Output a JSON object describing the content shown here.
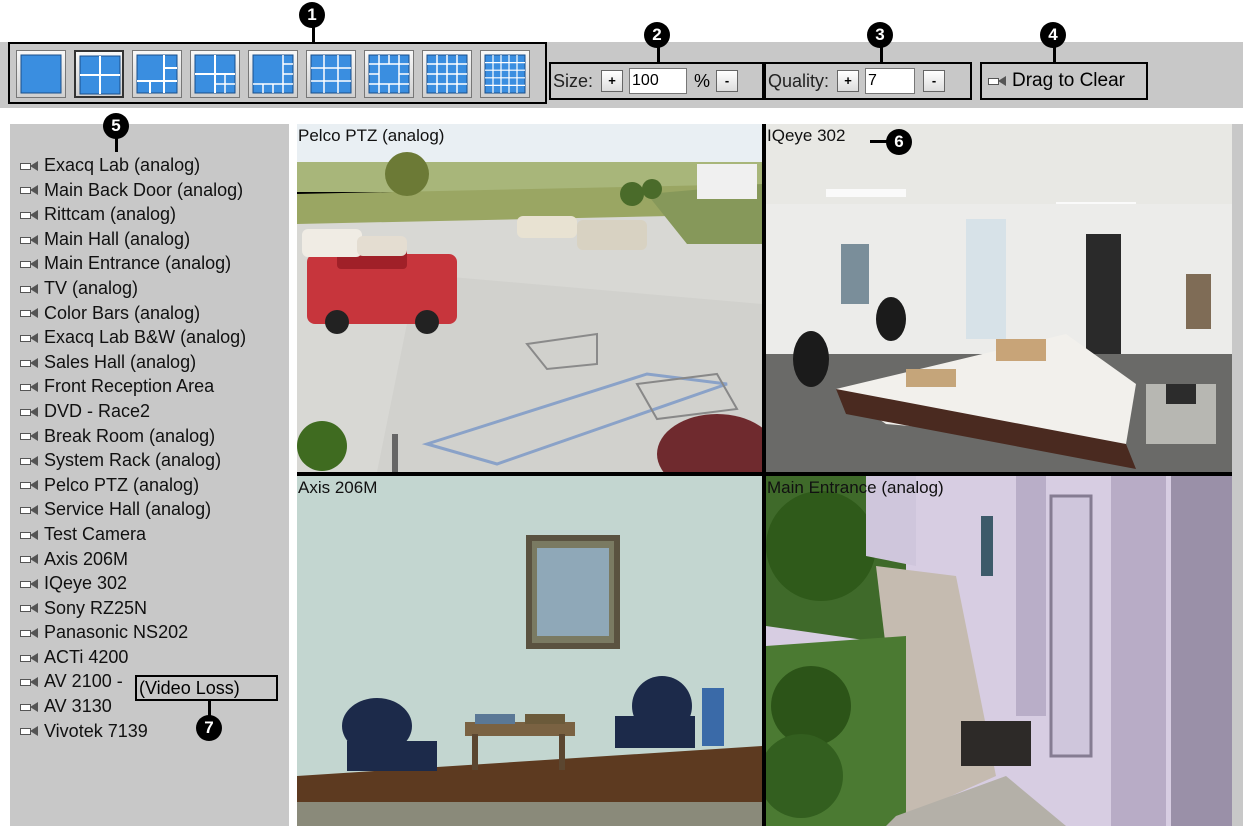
{
  "toolbar": {
    "layouts": [
      {
        "name": "1x1"
      },
      {
        "name": "2x2"
      },
      {
        "name": "1+5"
      },
      {
        "name": "1+7"
      },
      {
        "name": "1+9"
      },
      {
        "name": "3x3"
      },
      {
        "name": "1+12"
      },
      {
        "name": "4x4"
      },
      {
        "name": "5x5"
      }
    ],
    "size": {
      "label": "Size:",
      "plus": "+",
      "value": "100",
      "unit": "%",
      "minus": "-"
    },
    "quality": {
      "label": "Quality:",
      "plus": "+",
      "value": "7",
      "minus": "-"
    },
    "clear": {
      "label": "Drag to Clear"
    }
  },
  "callouts": [
    "1",
    "2",
    "3",
    "4",
    "5",
    "6",
    "7"
  ],
  "cameras": [
    "Exacq Lab (analog)",
    "Main Back Door (analog)",
    "Rittcam (analog)",
    "Main Hall (analog)",
    "Main Entrance (analog)",
    "TV (analog)",
    "Color Bars (analog)",
    "Exacq Lab B&W (analog)",
    "Sales Hall (analog)",
    "Front Reception Area",
    "DVD - Race2",
    "Break Room (analog)",
    "System Rack (analog)",
    "Pelco PTZ (analog)",
    "Service Hall (analog)",
    "Test Camera",
    "Axis 206M",
    "IQeye 302",
    "Sony RZ25N",
    "Panasonic NS202",
    "ACTi 4200",
    "AV 2100 - ",
    "AV 3130",
    "Vivotek 7139"
  ],
  "video_loss_label": "(Video Loss)",
  "tiles": [
    {
      "title": "Pelco PTZ (analog)"
    },
    {
      "title": "IQeye 302"
    },
    {
      "title": "Axis 206M"
    },
    {
      "title": "Main Entrance (analog)"
    }
  ]
}
